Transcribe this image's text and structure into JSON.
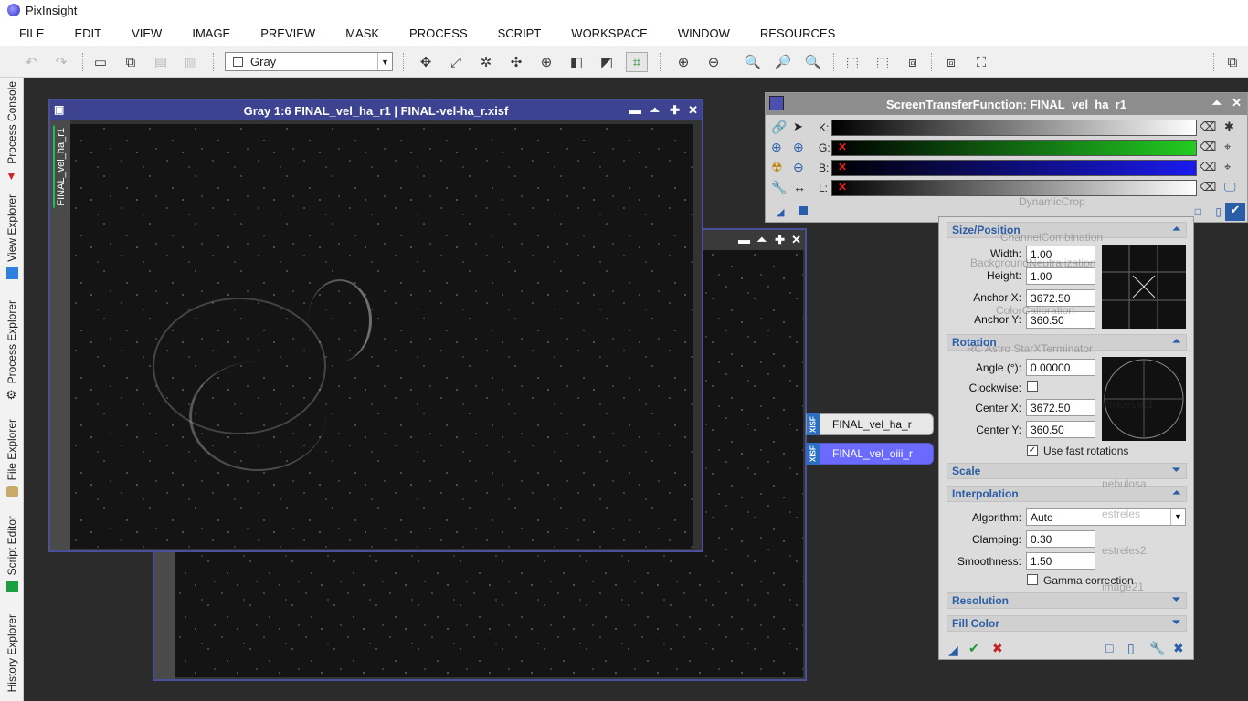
{
  "app": {
    "title": "PixInsight"
  },
  "menu": [
    "FILE",
    "EDIT",
    "VIEW",
    "IMAGE",
    "PREVIEW",
    "MASK",
    "PROCESS",
    "SCRIPT",
    "WORKSPACE",
    "WINDOW",
    "RESOURCES"
  ],
  "toolbar": {
    "mode_combo": "Gray"
  },
  "sidebar": {
    "tabs": [
      "Process Console",
      "View Explorer",
      "Process Explorer",
      "File Explorer",
      "Script Editor",
      "History Explorer"
    ]
  },
  "image_window_1": {
    "title": "Gray 1:6 FINAL_vel_ha_r1 | FINAL-vel-ha_r.xisf",
    "side_label": "FINAL_vel_ha_r1"
  },
  "view_icons": [
    {
      "label": "FINAL_vel_ha_r",
      "badge": "XISF"
    },
    {
      "label": "FINAL_vel_oiii_r",
      "badge": "XISF"
    }
  ],
  "stf": {
    "title": "ScreenTransferFunction: FINAL_vel_ha_r1",
    "channels": [
      "K:",
      "G:",
      "B:",
      "L:"
    ]
  },
  "dynamic_crop": {
    "sections": {
      "size": "Size/Position",
      "rotation": "Rotation",
      "scale": "Scale",
      "interpolation": "Interpolation",
      "resolution": "Resolution",
      "fill": "Fill Color"
    },
    "size_position": {
      "width_label": "Width:",
      "width": "1.00",
      "height_label": "Height:",
      "height": "1.00",
      "anchor_x_label": "Anchor X:",
      "anchor_x": "3672.50",
      "anchor_y_label": "Anchor Y:",
      "anchor_y": "360.50"
    },
    "rotation": {
      "angle_label": "Angle (°):",
      "angle": "0.00000",
      "clockwise_label": "Clockwise:",
      "center_x_label": "Center X:",
      "center_x": "3672.50",
      "center_y_label": "Center Y:",
      "center_y": "360.50",
      "fast_rotations": "Use fast rotations"
    },
    "interpolation": {
      "algorithm_label": "Algorithm:",
      "algorithm": "Auto",
      "clamping_label": "Clamping:",
      "clamping": "0.30",
      "smoothness_label": "Smoothness:",
      "smoothness": "1.50",
      "gamma": "Gamma correction"
    }
  },
  "ghost_processes": [
    "DynamicCrop",
    "ChannelCombination",
    "BackgroundNeutralization",
    "ColorCalibration",
    "RC Astro StarXTerminator",
    "Process01",
    "nebulosa",
    "estreles",
    "estreles2",
    "image21"
  ]
}
